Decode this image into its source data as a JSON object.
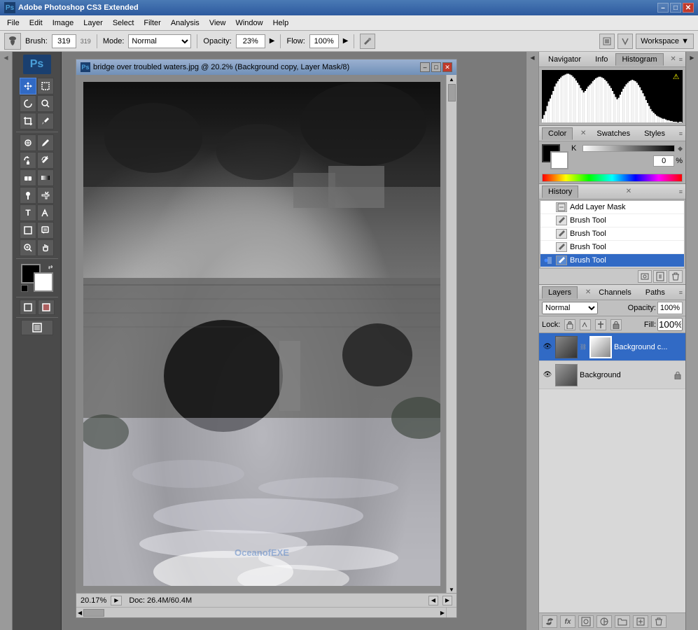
{
  "app": {
    "title": "Adobe Photoshop CS3 Extended",
    "ps_logo": "Ps"
  },
  "titlebar": {
    "title": "Adobe Photoshop CS3 Extended",
    "minimize": "–",
    "maximize": "□",
    "close": "✕"
  },
  "menubar": {
    "items": [
      "File",
      "Edit",
      "Image",
      "Layer",
      "Select",
      "Filter",
      "Analysis",
      "View",
      "Window",
      "Help"
    ]
  },
  "optionsbar": {
    "brush_label": "Brush:",
    "brush_size": "319",
    "mode_label": "Mode:",
    "mode_value": "Normal",
    "opacity_label": "Opacity:",
    "opacity_value": "23%",
    "flow_label": "Flow:",
    "flow_value": "100%",
    "workspace_label": "Workspace ▼"
  },
  "canvas_window": {
    "title": "bridge over troubled waters.jpg @ 20.2% (Background copy, Layer Mask/8)",
    "zoom": "20.17%",
    "doc_size": "Doc: 26.4M/60.4M"
  },
  "histogram_panel": {
    "tabs": [
      "Navigator",
      "Info",
      "Histogram"
    ],
    "active_tab": "Histogram"
  },
  "color_panel": {
    "tabs": [
      "Color",
      "Swatches",
      "Styles"
    ],
    "active_tab": "Color",
    "k_label": "K",
    "k_value": "0",
    "percent": "%"
  },
  "history_panel": {
    "title": "History",
    "items": [
      {
        "label": "Add Layer Mask",
        "active": false
      },
      {
        "label": "Brush Tool",
        "active": false
      },
      {
        "label": "Brush Tool",
        "active": false
      },
      {
        "label": "Brush Tool",
        "active": false
      },
      {
        "label": "Brush Tool",
        "active": true
      }
    ]
  },
  "layers_panel": {
    "tabs": [
      "Layers",
      "Channels",
      "Paths"
    ],
    "active_tab": "Layers",
    "blend_mode": "Normal",
    "opacity_label": "Opacity:",
    "opacity_value": "100%",
    "fill_label": "Fill:",
    "fill_value": "100%",
    "lock_label": "Lock:",
    "layers": [
      {
        "name": "Background c...",
        "active": true,
        "has_mask": true,
        "locked": false,
        "visible": true
      },
      {
        "name": "Background",
        "active": false,
        "has_mask": false,
        "locked": true,
        "visible": true
      }
    ]
  },
  "tools": {
    "items": [
      "M",
      "M",
      "L",
      "L",
      "C",
      "B",
      "S",
      "P",
      "T",
      "E",
      "G",
      "H",
      "Z"
    ]
  }
}
